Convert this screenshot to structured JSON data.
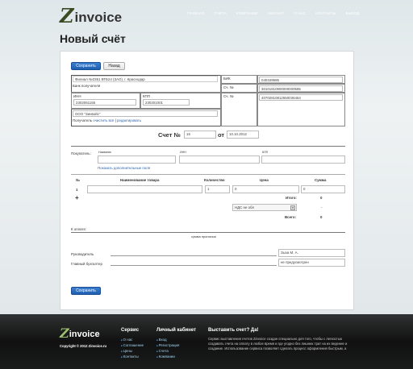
{
  "brand": {
    "z": "Z",
    "rest": "invoice"
  },
  "nav": [
    "Главная",
    "Счета",
    "Компании",
    "Аккаунт",
    "О нас",
    "Контакты",
    "Выход"
  ],
  "page_title": "Новый счёт",
  "toolbar": {
    "save": "Сохранить",
    "back": "Назад"
  },
  "bank": {
    "bank_name": "Филиал №2351 ВТБ24 (ЗАО), г. Краснодар",
    "bank_label": "Банк получателя",
    "inn_label": "ИНН",
    "inn_value": "2302061155",
    "kpp_label": "КПП",
    "kpp_value": "230201001",
    "company": "ООО \"Зинвойс\"",
    "recipient_label": "Получатель",
    "clear_all": "очистить всё",
    "separator": "|",
    "edit": "редактировать",
    "bik_label": "БИК",
    "bik_value": "040349585",
    "corr_label": "Сч. №",
    "corr_value": "30101810900000000585",
    "acc_label": "Сч. №",
    "acc_value": "40702810812550036464"
  },
  "invoice": {
    "label": "Счет №",
    "number": "16",
    "from": "от",
    "date": "10.10.2012"
  },
  "buyer": {
    "label": "Покупатель:",
    "col_name": "Название",
    "col_inn": "ИНН",
    "col_kpp": "КПП",
    "more_link": "Показать дополнительные поля"
  },
  "items": {
    "headers": [
      "№",
      "Наименование товара",
      "Количество",
      "Цена",
      "Сумма"
    ],
    "rows": [
      {
        "num": "1",
        "name": "",
        "qty": "1",
        "price": "0",
        "sum": "0"
      }
    ],
    "add": "+"
  },
  "totals": {
    "total_label": "Итого:",
    "total_value": "0",
    "vat_option": "НДС не обл",
    "vat_value": "-",
    "grand_label": "Всего:",
    "grand_value": "0"
  },
  "payment": {
    "label": "К оплате:",
    "caption": "сумма прописью"
  },
  "signatures": {
    "director_label": "Руководитель",
    "director_value": "Зыза М. А.",
    "accountant_label": "Главный бухгалтер",
    "accountant_value": "не предусмотрен"
  },
  "footer": {
    "copyright": "Copyright © 2012 Zinvoice.ru",
    "service_head": "Сервис",
    "service_links": [
      "О нас",
      "Соглашение",
      "Цены",
      "Контакты"
    ],
    "cabinet_head": "Личный кабинет",
    "cabinet_links": [
      "Вход",
      "Регистрация",
      "Счета",
      "Компании"
    ],
    "promo_head": "Выставить счет? Да!",
    "promo_text": "Сервис выставления счетов Zinvoice создан специально для того, чтобы с легкостью создавать счета на оплату в любое время и где угодно без лишних трат на их ведение и создание. Использование сервиса позволяет сделать процесс оформления быстрым, а также хранить ваши счета на сервере."
  }
}
